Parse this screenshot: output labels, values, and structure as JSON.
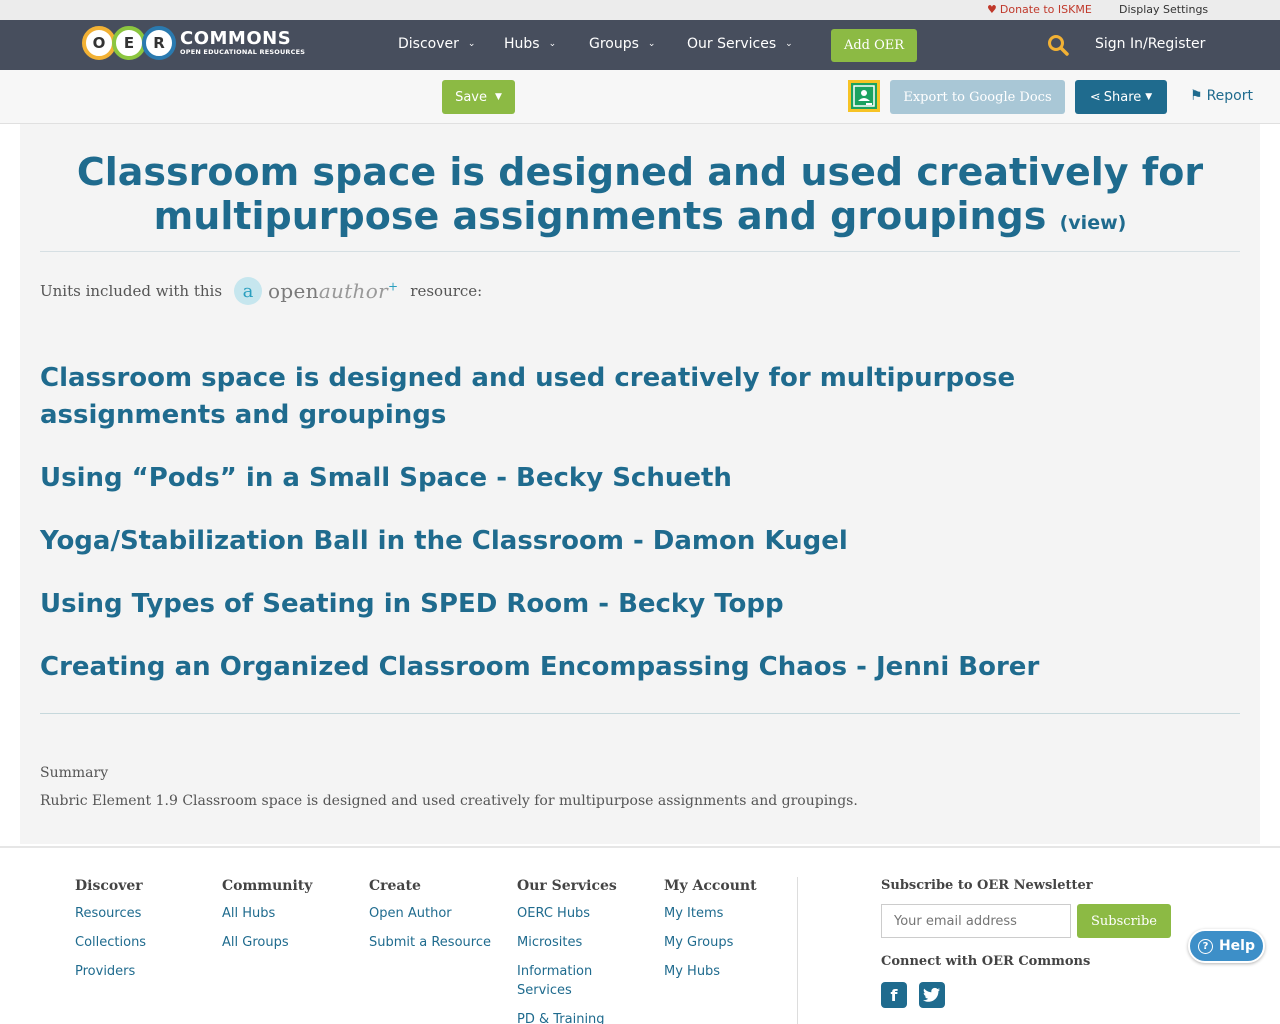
{
  "utility": {
    "donate": "Donate to ISKME",
    "display_settings": "Display Settings"
  },
  "logo": {
    "letters": [
      "O",
      "E",
      "R"
    ],
    "main": "COMMONS",
    "sub": "OPEN EDUCATIONAL RESOURCES"
  },
  "nav": {
    "items": [
      "Discover",
      "Hubs",
      "Groups",
      "Our Services"
    ],
    "add_oer": "Add OER",
    "signin": "Sign In/Register"
  },
  "actions": {
    "save": "Save",
    "export": "Export to Google Docs",
    "share": "Share",
    "report": "Report"
  },
  "page": {
    "title": "Classroom space is designed and used creatively for multipurpose assignments and groupings",
    "view_link": "(view)",
    "units_prefix": "Units included with this",
    "openauthor_open": "open",
    "openauthor_author": "author",
    "units_suffix": "resource:",
    "units": [
      "Classroom space is designed and used creatively for multipurpose assignments and groupings",
      "Using “Pods” in a Small Space - Becky Schueth",
      "Yoga/Stabilization Ball in the Classroom - Damon Kugel",
      "Using Types of Seating in SPED Room - Becky Topp",
      "Creating an Organized Classroom Encompassing Chaos - Jenni Borer"
    ],
    "summary_label": "Summary",
    "summary_text": "Rubric Element 1.9 Classroom space is designed and used creatively for multipurpose assignments and groupings."
  },
  "footer": {
    "discover": {
      "title": "Discover",
      "links": [
        "Resources",
        "Collections",
        "Providers"
      ]
    },
    "community": {
      "title": "Community",
      "links": [
        "All Hubs",
        "All Groups"
      ]
    },
    "create": {
      "title": "Create",
      "links": [
        "Open Author",
        "Submit a Resource"
      ]
    },
    "services": {
      "title": "Our Services",
      "links": [
        "OERC Hubs",
        "Microsites",
        "Information Services",
        "PD & Training"
      ]
    },
    "account": {
      "title": "My Account",
      "links": [
        "My Items",
        "My Groups",
        "My Hubs"
      ]
    },
    "newsletter_title": "Subscribe to OER Newsletter",
    "email_placeholder": "Your email address",
    "subscribe": "Subscribe",
    "connect_title": "Connect with OER Commons"
  },
  "help": "Help",
  "colors": {
    "nav_bg": "#474e5d",
    "accent_green": "#8cba44",
    "link_blue": "#1f6b8e"
  }
}
